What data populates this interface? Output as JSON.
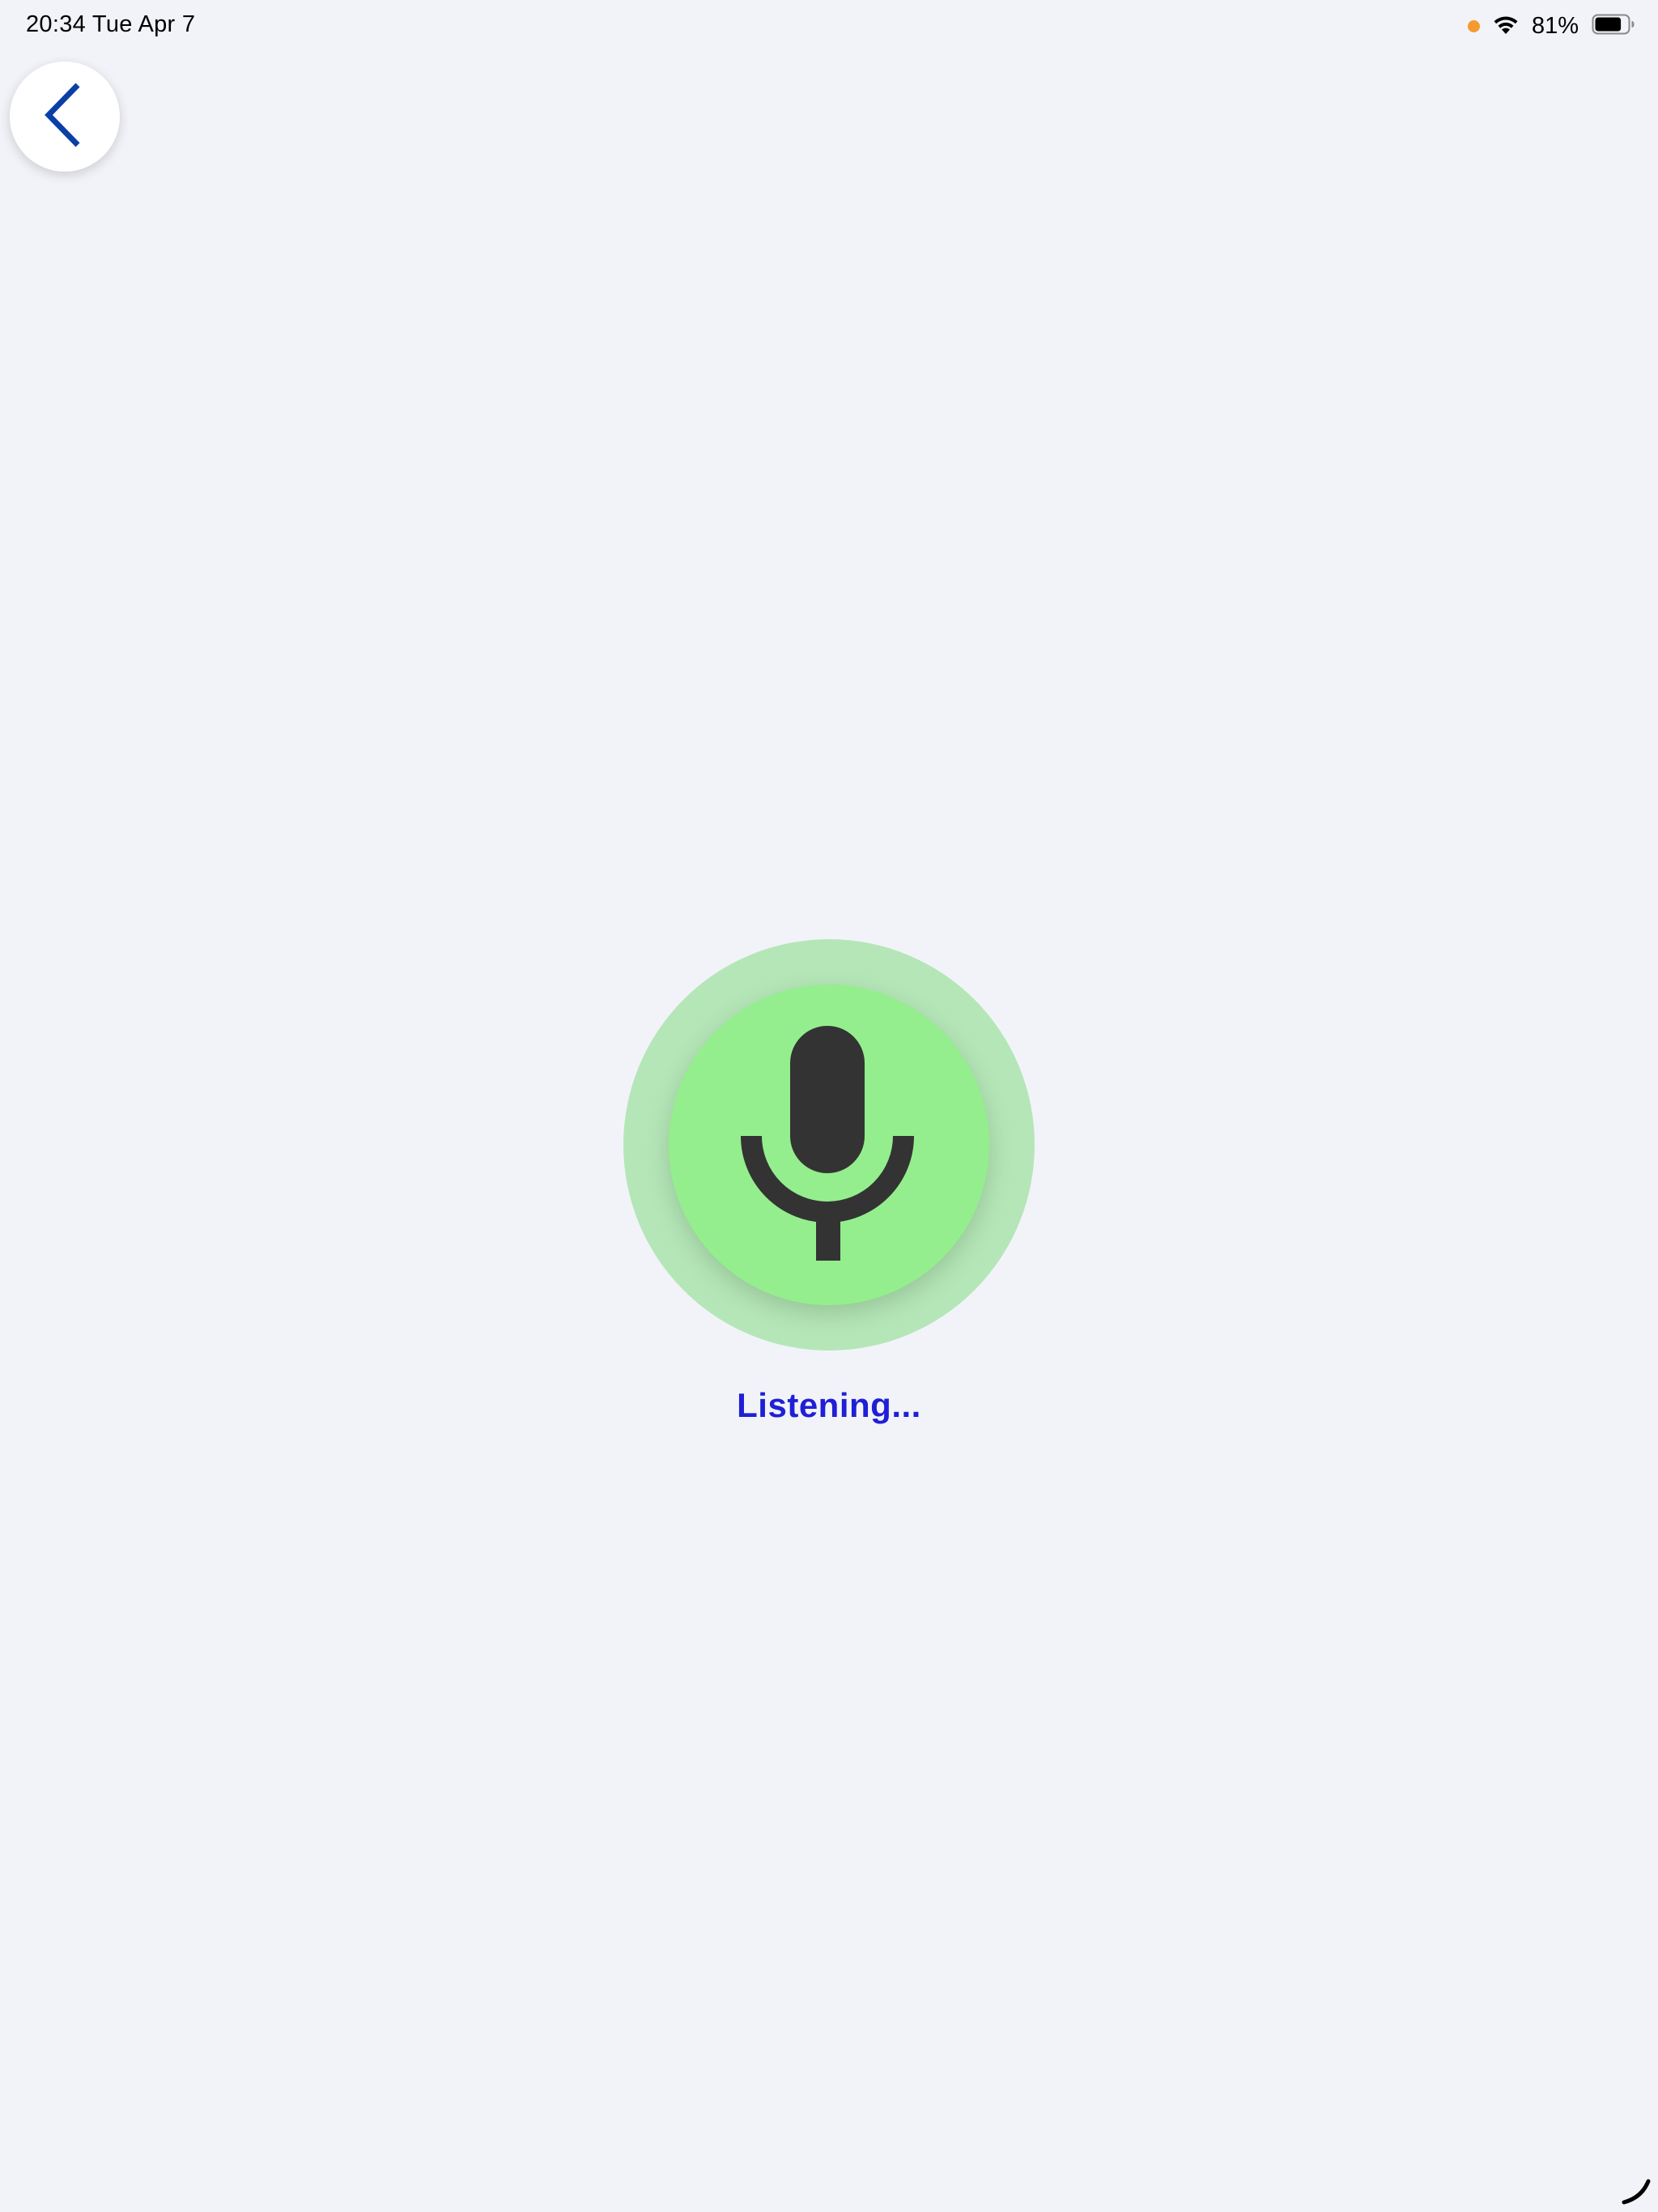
{
  "status_bar": {
    "time_date": "20:34   Tue Apr 7",
    "battery_percent": "81%",
    "battery_level": 0.81,
    "mic_indicator_color": "#f59a2e",
    "icons": [
      "wifi-icon",
      "battery-icon"
    ]
  },
  "back_button": {
    "icon": "chevron-left-icon",
    "color": "#0a3fa8"
  },
  "voice": {
    "icon": "microphone-icon",
    "status_text": "Listening...",
    "colors": {
      "outer_ring": "#b5e6b8",
      "inner_circle": "#94ee8e",
      "icon": "#333333",
      "text": "#1f1fd6"
    }
  }
}
